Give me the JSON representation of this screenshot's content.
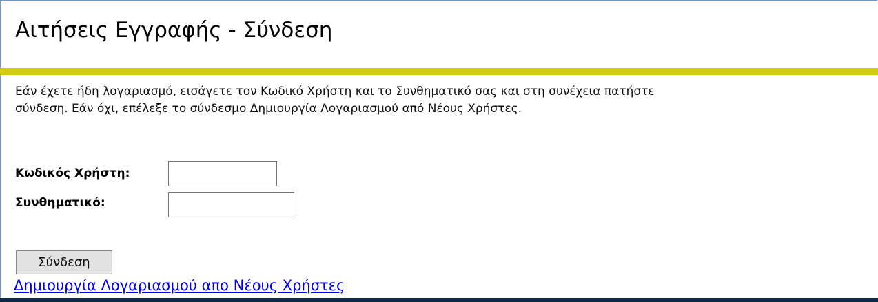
{
  "page": {
    "title": "Αιτήσεις Εγγραφής - Σύνδεση",
    "intro": "Εάν έχετε ήδη λογαριασμό, εισάγετε τον Κωδικό Χρήστη και το Συνθηματικό σας και στη συνέχεια πατήστε\nσύνδεση. Εάν όχι, επέλεξε το σύνδεσμο Δημιουργία Λογαριασμού από Νέους Χρήστες."
  },
  "form": {
    "username_label": "Κωδικός Χρήστη:",
    "username_value": "",
    "password_label": "Συνθηματικό:",
    "password_value": "",
    "login_label": "Σύνδεση"
  },
  "links": {
    "create_account": "Δημιουργία Λογαριασμού απο Νέους Χρήστες"
  },
  "colors": {
    "title_rule": "#d2cb13",
    "link": "#0000ee",
    "bottom_band": "#0f2846",
    "frame_border": "#6f9ad1"
  }
}
